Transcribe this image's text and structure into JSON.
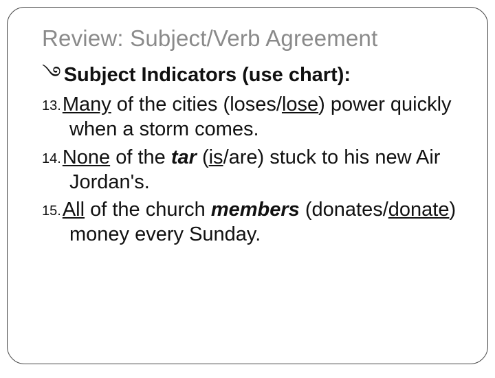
{
  "title": "Review: Subject/Verb Agreement",
  "bullet_glyph": "࿓",
  "bullet_text": "Subject Indicators (use chart):",
  "items": {
    "n13": "13.",
    "t13a": "Many",
    "t13b": " of the cities (loses/",
    "t13c": "lose",
    "t13d": ") power quickly when a storm comes.",
    "n14": "14.",
    "t14a": "None",
    "t14b": " of the ",
    "t14c": "tar",
    "t14d": " (",
    "t14e": "is",
    "t14f": "/are) stuck to his new Air Jordan's.",
    "n15": "15.",
    "t15a": "All",
    "t15b": " of the church ",
    "t15c": "members",
    "t15d": " (donates/",
    "t15e": "donate",
    "t15f": ") money every Sunday."
  }
}
